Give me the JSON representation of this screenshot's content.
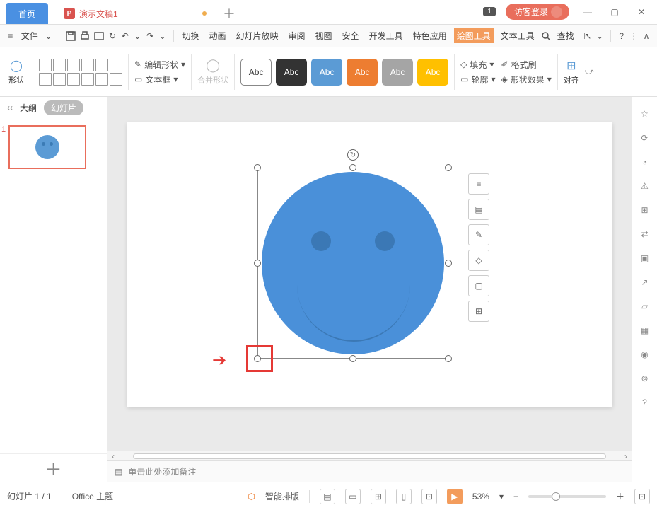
{
  "tabs": {
    "home": "首页",
    "doc": "演示文稿1"
  },
  "login": "访客登录",
  "badge": "1",
  "menu": {
    "file": "文件",
    "items": [
      "切换",
      "动画",
      "幻灯片放映",
      "审阅",
      "视图",
      "安全",
      "开发工具",
      "特色应用",
      "绘图工具",
      "文本工具"
    ],
    "active_index": 8,
    "search": "查找"
  },
  "ribbon": {
    "shape": "形状",
    "edit_shape": "编辑形状",
    "textbox": "文本框",
    "merge": "合并形状",
    "styles": [
      {
        "label": "Abc",
        "bg": "#ffffff",
        "fg": "#333",
        "bd": "#888"
      },
      {
        "label": "Abc",
        "bg": "#333333",
        "fg": "#fff",
        "bd": "#333"
      },
      {
        "label": "Abc",
        "bg": "#5b9bd5",
        "fg": "#fff",
        "bd": "#5b9bd5"
      },
      {
        "label": "Abc",
        "bg": "#ed7d31",
        "fg": "#fff",
        "bd": "#ed7d31"
      },
      {
        "label": "Abc",
        "bg": "#a5a5a5",
        "fg": "#fff",
        "bd": "#a5a5a5"
      },
      {
        "label": "Abc",
        "bg": "#ffc000",
        "fg": "#fff",
        "bd": "#ffc000"
      }
    ],
    "fill": "填充",
    "format_painter": "格式刷",
    "outline": "轮廓",
    "shape_effects": "形状效果",
    "align": "对齐"
  },
  "leftpanel": {
    "outline": "大纲",
    "slides": "幻灯片",
    "slide_num": "1"
  },
  "notes_placeholder": "单击此处添加备注",
  "status": {
    "slide_pos": "幻灯片 1 / 1",
    "theme": "Office 主题",
    "smart_layout": "智能排版",
    "zoom": "53%"
  },
  "float_tools": [
    "≡",
    "▤",
    "✎",
    "◇",
    "▢",
    "⊞"
  ],
  "side_icons": [
    "☆",
    "⟳",
    "◔",
    "⚠",
    "⊞",
    "⇄",
    "▣",
    "↗",
    "▱",
    "▦",
    "◉",
    "⊚",
    "?"
  ]
}
